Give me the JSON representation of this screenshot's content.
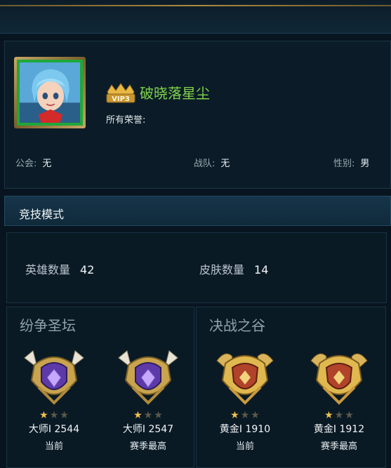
{
  "profile": {
    "vip_level": "VIP3",
    "name": "破晓落星尘",
    "honor_label": "所有荣誉:",
    "guild_label": "公会:",
    "guild_value": "无",
    "team_label": "战队:",
    "team_value": "无",
    "gender_label": "性别:",
    "gender_value": "男"
  },
  "section": {
    "title": "竞技模式"
  },
  "counts": {
    "heroes_label": "英雄数量",
    "heroes_value": "42",
    "skins_label": "皮肤数量",
    "skins_value": "14"
  },
  "modes": [
    {
      "title": "纷争圣坛",
      "ranks": [
        {
          "tier": "master",
          "stars": 1,
          "max_stars": 3,
          "score": "大师Ⅰ 2544",
          "label": "当前"
        },
        {
          "tier": "master",
          "stars": 1,
          "max_stars": 3,
          "score": "大师Ⅰ 2547",
          "label": "赛季最高"
        }
      ]
    },
    {
      "title": "决战之谷",
      "ranks": [
        {
          "tier": "gold",
          "stars": 1,
          "max_stars": 3,
          "score": "黄金Ⅰ 1910",
          "label": "当前"
        },
        {
          "tier": "gold",
          "stars": 1,
          "max_stars": 3,
          "score": "黄金Ⅰ 1912",
          "label": "赛季最高"
        }
      ]
    }
  ],
  "colors": {
    "name": "#7fd34a",
    "star_on": "#f2c14a",
    "accent_gold": "#c9a866"
  }
}
